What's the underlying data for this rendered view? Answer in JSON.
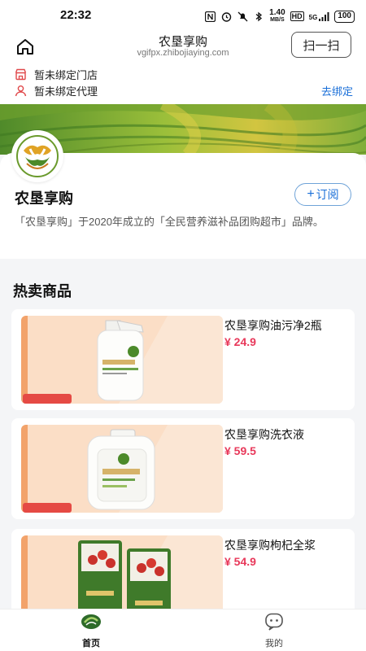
{
  "status_bar": {
    "time": "22:32",
    "network_speed": "1.40",
    "network_unit": "MB/S",
    "hd_label": "HD",
    "signal_label": "5G",
    "battery": "100"
  },
  "header": {
    "title": "农垦享购",
    "subtitle": "vgifpx.zhibojiaying.com",
    "scan_label": "扫一扫"
  },
  "binding": {
    "store_text": "暂未绑定门店",
    "agent_text": "暂未绑定代理",
    "bind_link": "去绑定"
  },
  "store": {
    "name": "农垦享购",
    "follow_label": "订阅",
    "description": "「农垦享购」于2020年成立的「全民营养滋补品团购超市」品牌。"
  },
  "hot": {
    "title": "热卖商品",
    "products": [
      {
        "name": "农垦享购油污净2瓶",
        "price": "¥ 24.9"
      },
      {
        "name": "农垦享购洗衣液",
        "price": "¥ 59.5"
      },
      {
        "name": "农垦享购枸杞全浆",
        "price": "¥ 54.9"
      }
    ]
  },
  "tabbar": {
    "home_label": "首页",
    "mine_label": "我的"
  },
  "colors": {
    "accent_blue": "#1a6fd8",
    "price_red": "#e8385a",
    "binding_icon_red": "#e0484a"
  }
}
